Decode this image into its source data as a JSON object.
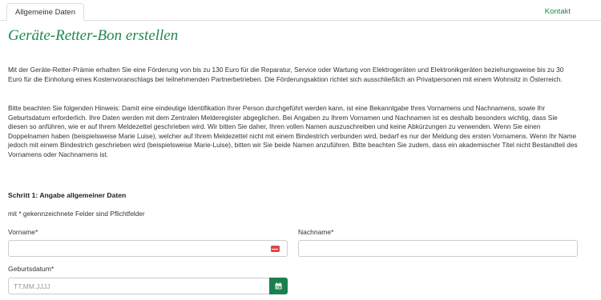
{
  "tabs": [
    {
      "label": "Allgemeine Daten",
      "active": true
    }
  ],
  "header": {
    "contact_link": "Kontakt"
  },
  "page": {
    "title": "Geräte-Retter-Bon erstellen",
    "intro": "Mit der Geräte-Retter-Prämie erhalten Sie eine Förderung von bis zu 130 Euro für die Reparatur, Service oder Wartung von Elektrogeräten und Elektronikgeräten beziehungsweise bis zu 30 Euro für die Einholung eines Kostenvoranschlags bei teilnehmenden Partnerbetrieben. Die Förderungsaktion richtet sich ausschließlich an Privatpersonen mit einem Wohnsitz in Österreich.",
    "notice": "Bitte beachten Sie folgenden Hinweis: Damit eine eindeutige Identifikation Ihrer Person durchgeführt werden kann, ist eine Bekanntgabe Ihres Vornamens und Nachnamens, sowie Ihr Geburtsdatum erforderlich. Ihre Daten werden mit dem Zentralen Melderegister abgeglichen. Bei Angaben zu Ihrem Vornamen und Nachnamen ist es deshalb besonders wichtig, dass Sie diesen so anführen, wie er auf Ihrem Meldezettel geschrieben wird. Wir bitten Sie daher, Ihren vollen Namen auszuschreiben und keine Abkürzungen zu verwenden. Wenn Sie einen Doppelnamen haben (beispielsweise Marie Luise), welcher auf Ihrem Meldezettel nicht mit einem Bindestrich verbunden wird, bedarf es nur der Meldung des ersten Vornamens. Wenn Ihr Name jedoch mit einem Bindestrich geschrieben wird (beispielsweise Marie-Luise), bitten wir Sie beide Namen anzuführen. Bitte beachten Sie zudem, dass ein akademischer Titel nicht Bestandteil des Vornamens oder Nachnamens ist."
  },
  "form": {
    "step_heading": "Schritt 1: Angabe allgemeiner Daten",
    "required_note": "mit * gekennzeichnete Felder sind Pflichtfelder",
    "first_name": {
      "label": "Vorname*",
      "value": ""
    },
    "last_name": {
      "label": "Nachname*",
      "value": ""
    },
    "birth_date": {
      "label": "Geburtsdatum*",
      "placeholder": "TT.MM.JJJJ",
      "value": ""
    }
  },
  "icons": {
    "first_name_field": "autofill-card-icon",
    "birth_date_button": "calendar-icon"
  },
  "colors": {
    "accent_green": "#1e8a50",
    "button_green": "#1a7f4b",
    "autofill_red": "#e04848"
  }
}
